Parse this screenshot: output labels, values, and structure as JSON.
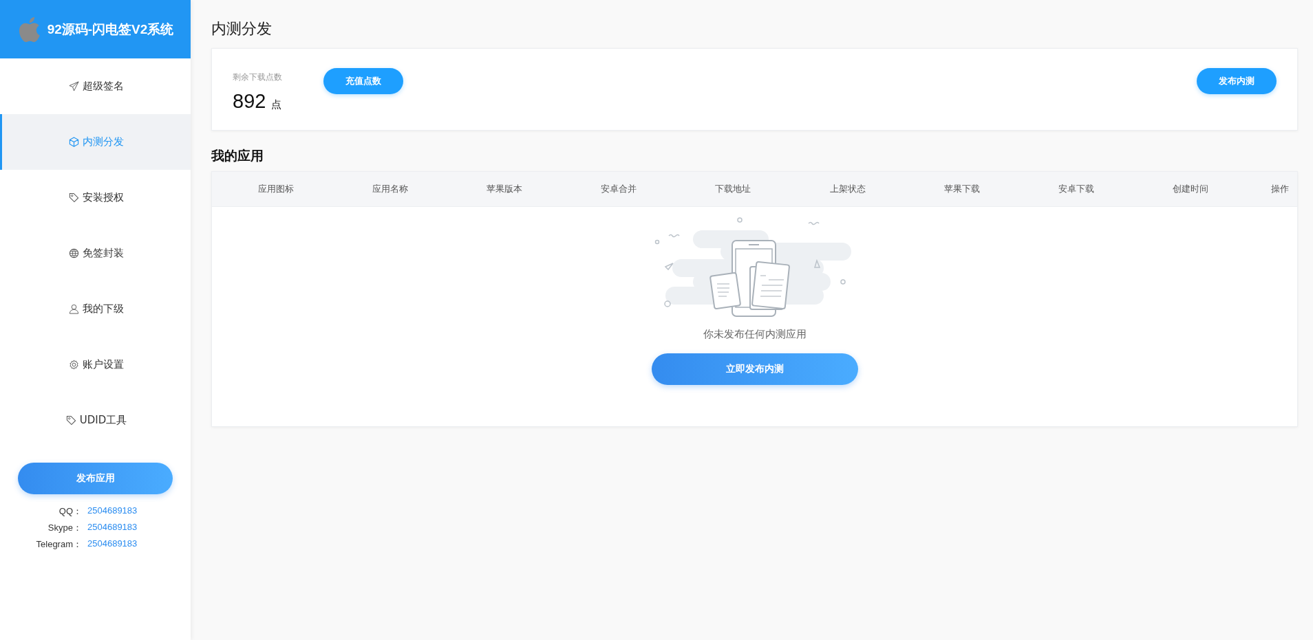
{
  "sidebar": {
    "title": "92源码-闪电签V2系统",
    "items": [
      {
        "label": "超级签名",
        "selected": false
      },
      {
        "label": "内测分发",
        "selected": true
      },
      {
        "label": "安装授权",
        "selected": false
      },
      {
        "label": "免签封装",
        "selected": false
      },
      {
        "label": "我的下级",
        "selected": false
      },
      {
        "label": "账户设置",
        "selected": false
      },
      {
        "label": "UDID工具",
        "selected": false
      }
    ],
    "publish_button": "发布应用",
    "contacts": [
      {
        "label": "QQ：",
        "value": "2504689183"
      },
      {
        "label": "Skype：",
        "value": "2504689183"
      },
      {
        "label": "Telegram：",
        "value": "2504689183"
      }
    ]
  },
  "page_title": "内测分发",
  "points_card": {
    "label": "剩余下载点数",
    "value": "892",
    "unit": "点",
    "recharge_button": "充值点数",
    "publish_button": "发布内测"
  },
  "apps_title": "我的应用",
  "table": {
    "columns": [
      "应用图标",
      "应用名称",
      "苹果版本",
      "安卓合并",
      "下载地址",
      "上架状态",
      "苹果下载",
      "安卓下载",
      "创建时间",
      "操作"
    ],
    "empty_text": "你未发布任何内测应用",
    "empty_button": "立即发布内测"
  }
}
